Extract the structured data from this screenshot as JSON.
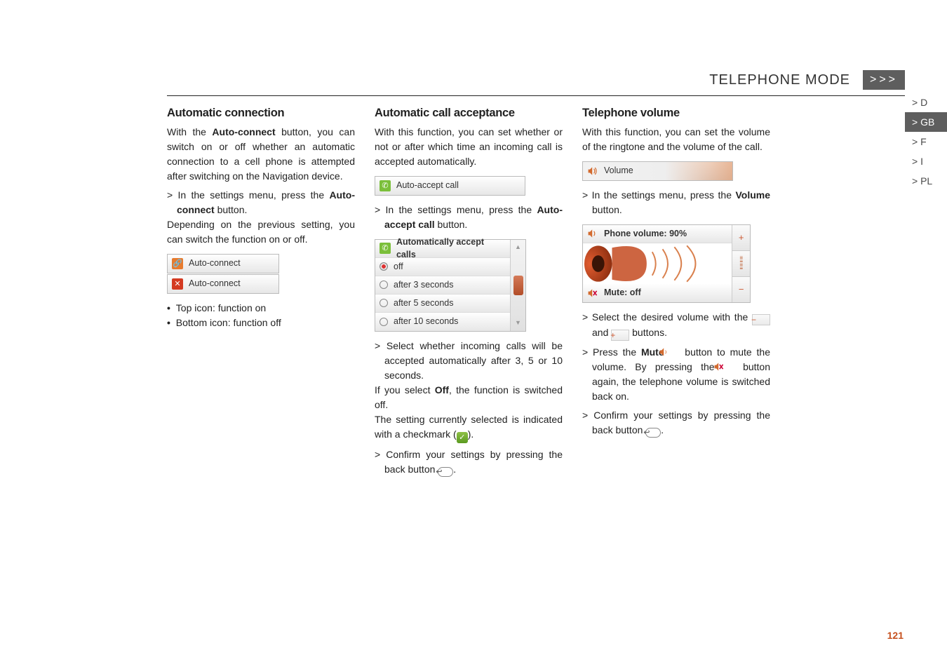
{
  "header": {
    "title": "TELEPHONE MODE",
    "chevron": ">>>"
  },
  "tabs": {
    "D": "> D",
    "GB": "> GB",
    "F": "> F",
    "I": "> I",
    "PL": "> PL"
  },
  "pagenum": "121",
  "col1": {
    "heading": "Automatic connection",
    "p1a": "With the ",
    "p1b": "Auto-connect",
    "p1c": " button, you can switch on or off whether an automatic connection to a cell phone is attempted after switching on the Navigation device.",
    "s1a": "In the settings menu, press the ",
    "s1b": "Auto-connect",
    "s1c": " button.",
    "p2": "Depending on the previous setting, you can switch the function on or off.",
    "mock1": "Auto-connect",
    "mock2": "Auto-connect",
    "b1": "Top icon: function on",
    "b2": "Bottom icon: function off"
  },
  "col2": {
    "heading": "Automatic call acceptance",
    "p1": "With this function, you can set whether or not or after which time an incoming call is accepted automatically.",
    "mockBar": "Auto-accept call",
    "s1a": "In the settings menu, press the ",
    "s1b": "Auto-accept call",
    "s1c": " button.",
    "list": {
      "title": "Automatically accept calls",
      "o1": "off",
      "o2": "after 3 seconds",
      "o3": "after 5 seconds",
      "o4": "after 10 seconds"
    },
    "s2": "Select whether incoming calls will be accepted automatically after 3, 5 or 10 seconds.",
    "p2a": "If you select ",
    "p2b": "Off",
    "p2c": ", the function is switched off.",
    "p3a": "The setting currently selected is indicated with a checkmark (",
    "p3b": ").",
    "s3a": "Confirm your settings by pressing the back button ",
    "s3b": "."
  },
  "col3": {
    "heading": "Telephone volume",
    "p1": "With this function, you can set the volume of the ringtone and the volume of the call.",
    "mockBar": "Volume",
    "s1a": "In the settings menu, press the ",
    "s1b": "Volume",
    "s1c": " button.",
    "mockTitle": "Phone volume: 90%",
    "mockMute": "Mute: off",
    "s2a": "Select the desired volume with the ",
    "s2b": " and ",
    "s2c": " buttons.",
    "s3a": "Press the ",
    "s3b": "Mute",
    "s3c": " button to mute the volume. By pressing the ",
    "s3d": " button again, the telephone volume is switched back on.",
    "s4a": "Confirm your settings by pressing the back button ",
    "s4b": "."
  }
}
